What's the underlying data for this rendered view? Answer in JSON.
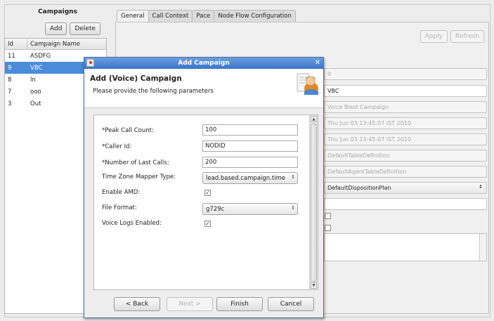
{
  "left_panel": {
    "title": "Campaigns",
    "add_button": "Add",
    "delete_button": "Delete",
    "columns": [
      "Id",
      "Campaign Name"
    ],
    "rows": [
      {
        "id": "11",
        "name": "ASDFG",
        "selected": false
      },
      {
        "id": "9",
        "name": "VBC",
        "selected": true
      },
      {
        "id": "8",
        "name": "ln",
        "selected": false
      },
      {
        "id": "7",
        "name": "ooo",
        "selected": false
      },
      {
        "id": "3",
        "name": "Out",
        "selected": false
      }
    ]
  },
  "tabs": [
    "General",
    "Call Context",
    "Pace",
    "Node Flow Configuration"
  ],
  "active_tab": "General",
  "toolbar": {
    "apply": "Apply",
    "refresh": "Refresh"
  },
  "background_fields": {
    "id": "9",
    "name": "VBC",
    "type": "Voice Blast Campaign",
    "created": "Thu Jun 03 13:45:07 IST 2010",
    "modified": "Thu Jun 03 13:45:07 IST 2010",
    "table_def": "DefaultTableDefinition",
    "agent_table_def": "DefaultAgentTableDefinition",
    "disposition_plan": "DefaultDispositionPlan",
    "blank": ""
  },
  "dialog": {
    "title": "Add Campaign",
    "heading": "Add (Voice) Campaign",
    "subtitle": "Please provide the following parameters",
    "fields": {
      "peak_call_count": {
        "label": "*Peak Call Count:",
        "value": "100"
      },
      "caller_id": {
        "label": "*Caller Id:",
        "value": "NODID"
      },
      "number_of_last_calls": {
        "label": "*Number of Last Calls:",
        "value": "200"
      },
      "time_zone_mapper_type": {
        "label": "Time Zone Mapper Type:",
        "value": "lead.based.campaign.time"
      },
      "enable_amd": {
        "label": "Enable AMD:",
        "checked": true
      },
      "file_format": {
        "label": "File Format:",
        "value": "g729c"
      },
      "voice_logs_enabled": {
        "label": "Voice Logs Enabled:",
        "checked": true
      }
    },
    "buttons": {
      "back": "< Back",
      "next": "Next >",
      "finish": "Finish",
      "cancel": "Cancel"
    }
  }
}
